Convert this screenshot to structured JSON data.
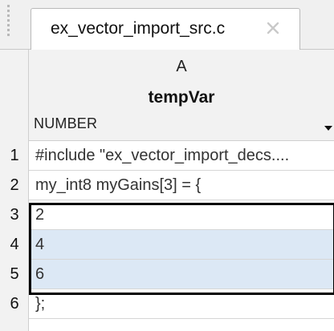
{
  "tab": {
    "title": "ex_vector_import_src.c",
    "close_icon": "close-icon"
  },
  "column": {
    "letter": "A",
    "name": "tempVar",
    "type": "NUMBER",
    "type_dropdown_icon": "caret-down-icon"
  },
  "rows": [
    {
      "num": "1",
      "value": "#include \"ex_vector_import_decs...."
    },
    {
      "num": "2",
      "value": "my_int8 myGains[3] = {"
    },
    {
      "num": "3",
      "value": "2"
    },
    {
      "num": "4",
      "value": "4"
    },
    {
      "num": "5",
      "value": "6"
    },
    {
      "num": "6",
      "value": "};"
    }
  ],
  "colors": {
    "selection_fill": "#dce8f5",
    "selection_border": "#000000",
    "header_bg": "#f2f2f2"
  }
}
